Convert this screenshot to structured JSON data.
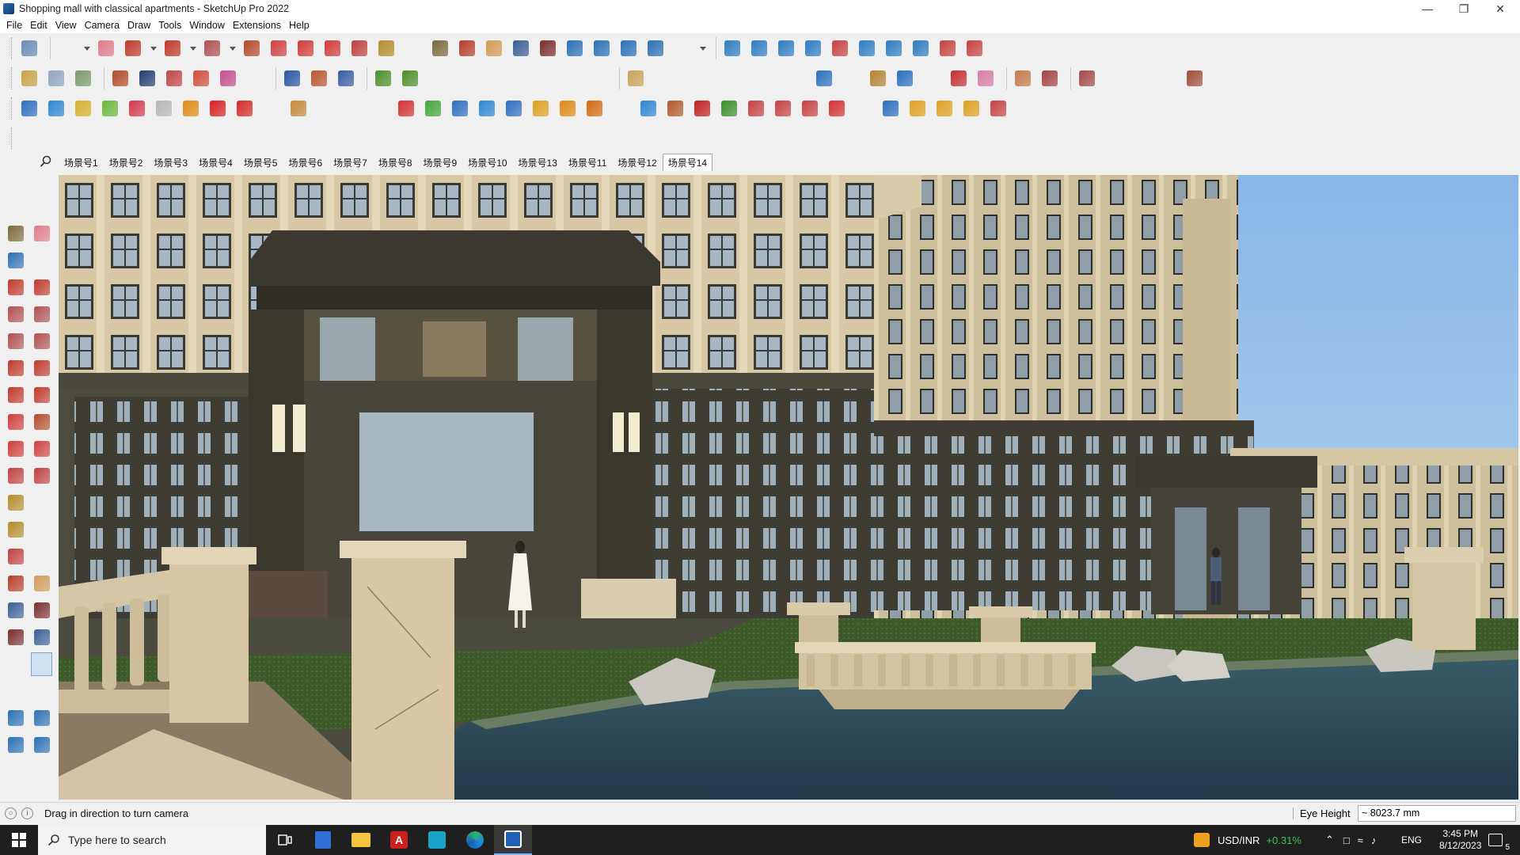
{
  "window": {
    "title": "Shopping mall with classical apartments - SketchUp Pro 2022",
    "controls": [
      "minimize",
      "restore",
      "close"
    ]
  },
  "menu": [
    "File",
    "Edit",
    "View",
    "Camera",
    "Draw",
    "Tools",
    "Window",
    "Extensions",
    "Help"
  ],
  "scenes": {
    "tabs": [
      "场景号1",
      "场景号2",
      "场景号3",
      "场景号4",
      "场景号5",
      "场景号6",
      "场景号7",
      "场景号8",
      "场景号9",
      "场景号10",
      "场景号13",
      "场景号11",
      "场景号12",
      "场景号14"
    ],
    "active": "场景号14"
  },
  "status": {
    "hint": "Drag in direction to turn camera",
    "measure_label": "Eye Height",
    "measure_value": "~ 8023.7 mm"
  },
  "taskbar": {
    "search_placeholder": "Type here to search",
    "ticker_symbol": "USD/INR",
    "ticker_change": "+0.31%",
    "language": "ENG",
    "time": "3:45 PM",
    "date": "8/12/2023",
    "notification_count": "5"
  },
  "colors": {
    "ticker_positive": "#3cc35a",
    "taskbar_bg": "#1f1f1f",
    "sky": "#a3c7ec",
    "water": "#2e4c57"
  }
}
